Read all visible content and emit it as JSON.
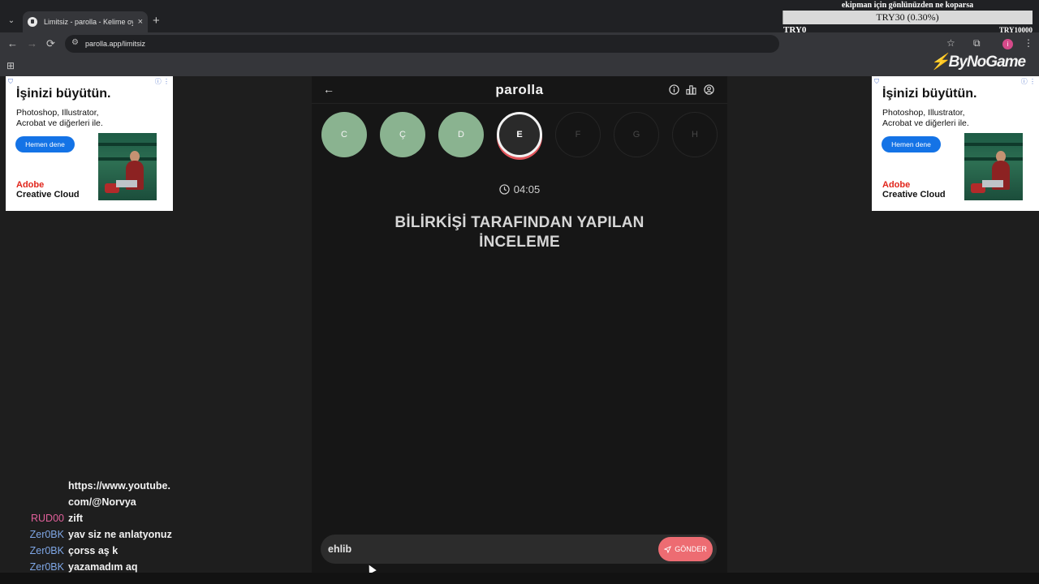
{
  "browser": {
    "tab_title": "Limitsiz - parolla - Kelime oyunu",
    "tab_close": "×",
    "new_tab": "+",
    "url": "parolla.app/limitsiz",
    "profile_initial": "i",
    "back": "←",
    "forward": "→",
    "reload": "⟳",
    "bookmark": "☆",
    "extensions": "⧉",
    "menu": "⋮",
    "apps": "⊞"
  },
  "donation": {
    "title": "ekipman için gönlünüzden ne koparsa",
    "amount": "TRY30 (0.30%)",
    "min": "TRY0",
    "max": "TRY10000",
    "progress_percent": 0.3
  },
  "bynogame": {
    "mark": "⚡",
    "text": "ByNoGame"
  },
  "ads": [
    {
      "heading": "İşinizi büyütün.",
      "text": "Photoshop, Illustrator, Acrobat ve diğerleri ile.",
      "button": "Hemen dene",
      "brand_line1": "Adobe",
      "brand_line2": "Creative Cloud"
    },
    {
      "heading": "İşinizi büyütün.",
      "text": "Photoshop, Illustrator, Acrobat ve diğerleri ile.",
      "button": "Hemen dene",
      "brand_line1": "Adobe",
      "brand_line2": "Creative Cloud"
    }
  ],
  "game": {
    "logo": "parolla",
    "back": "←",
    "letters": [
      {
        "letter": "C",
        "state": "done"
      },
      {
        "letter": "Ç",
        "state": "done"
      },
      {
        "letter": "D",
        "state": "done"
      },
      {
        "letter": "E",
        "state": "active"
      },
      {
        "letter": "F",
        "state": "future"
      },
      {
        "letter": "G",
        "state": "future"
      },
      {
        "letter": "H",
        "state": "future"
      }
    ],
    "timer": "04:05",
    "question": "BİLİRKİŞİ TARAFINDAN YAPILAN İNCELEME",
    "answer_value": "ehlib",
    "send_label": "GÖNDER"
  },
  "chat": [
    {
      "user": "",
      "color": "#ffffff",
      "message": "https://www.youtube."
    },
    {
      "user": "",
      "color": "#ffffff",
      "message": "com/@Norvya"
    },
    {
      "user": "RUD00",
      "color": "#e0609a",
      "message": "zift"
    },
    {
      "user": "Zer0BK",
      "color": "#7fa7e6",
      "message": "yav siz ne anlatyonuz"
    },
    {
      "user": "Zer0BK",
      "color": "#7fa7e6",
      "message": "çorss aş k"
    },
    {
      "user": "Zer0BK",
      "color": "#7fa7e6",
      "message": "yazamadım aq"
    }
  ]
}
